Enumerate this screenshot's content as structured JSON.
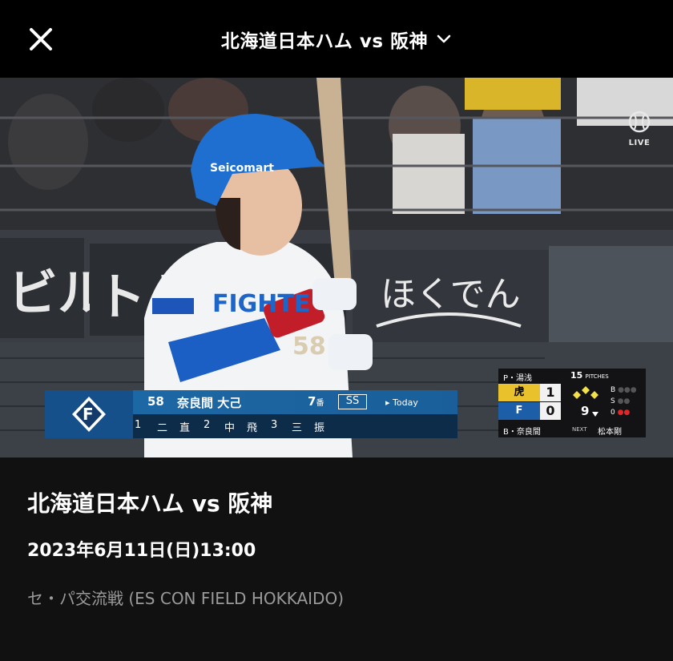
{
  "header": {
    "title": "北海道日本ハム vs 阪神"
  },
  "video": {
    "live_label": "LIVE",
    "batter": {
      "number": "58",
      "name": "奈良間 大己",
      "order": "7",
      "order_suffix": "番",
      "position": "SS",
      "today_label": "▸ Today",
      "history": [
        "1",
        "二",
        "直",
        "2",
        "中",
        "飛",
        "3",
        "三",
        "振"
      ]
    },
    "scoreboard": {
      "pitcher_label": "P・湯浅",
      "pitches": "15",
      "pitches_label": "PITCHES",
      "team1_score": "1",
      "team2_score": "0",
      "inning": "9",
      "balls_label": "B",
      "strikes_label": "S",
      "outs_label": "0",
      "batter_label": "B・奈良間",
      "next_label": "NEXT",
      "next_batter": "松本剛"
    }
  },
  "info": {
    "title": "北海道日本ハム vs 阪神",
    "datetime": "2023年6月11日(日)13:00",
    "subtitle": "セ・パ交流戦 (ES CON FIELD HOKKAIDO)"
  }
}
